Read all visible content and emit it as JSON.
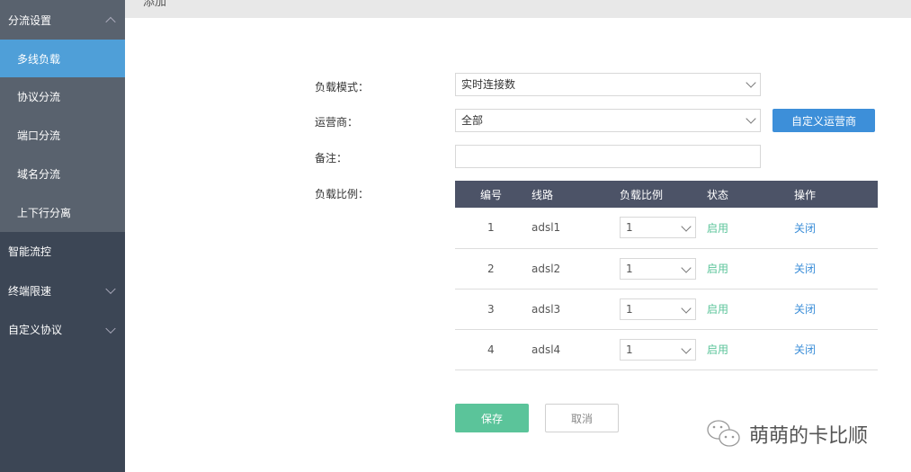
{
  "header": {
    "title": "添加"
  },
  "sidebar": {
    "group": "分流设置",
    "items": [
      "多线负载",
      "协议分流",
      "端口分流",
      "域名分流",
      "上下行分离"
    ],
    "others": [
      "智能流控",
      "终端限速",
      "自定义协议"
    ]
  },
  "form": {
    "mode_label": "负载模式：",
    "mode_value": "实时连接数",
    "isp_label": "运营商：",
    "isp_value": "全部",
    "custom_isp_button": "自定义运营商",
    "note_label": "备注：",
    "note_value": "",
    "ratio_label": "负载比例："
  },
  "table": {
    "headers": [
      "编号",
      "线路",
      "负载比例",
      "状态",
      "操作"
    ],
    "rows": [
      {
        "id": "1",
        "line": "adsl1",
        "ratio": "1",
        "status": "启用",
        "action": "关闭"
      },
      {
        "id": "2",
        "line": "adsl2",
        "ratio": "1",
        "status": "启用",
        "action": "关闭"
      },
      {
        "id": "3",
        "line": "adsl3",
        "ratio": "1",
        "status": "启用",
        "action": "关闭"
      },
      {
        "id": "4",
        "line": "adsl4",
        "ratio": "1",
        "status": "启用",
        "action": "关闭"
      }
    ]
  },
  "actions": {
    "save": "保存",
    "cancel": "取消"
  },
  "watermark": "萌萌的卡比顺",
  "colors": {
    "accent": "#3d8fd9",
    "success": "#5bc49a",
    "selected": "#4f9fd8"
  }
}
